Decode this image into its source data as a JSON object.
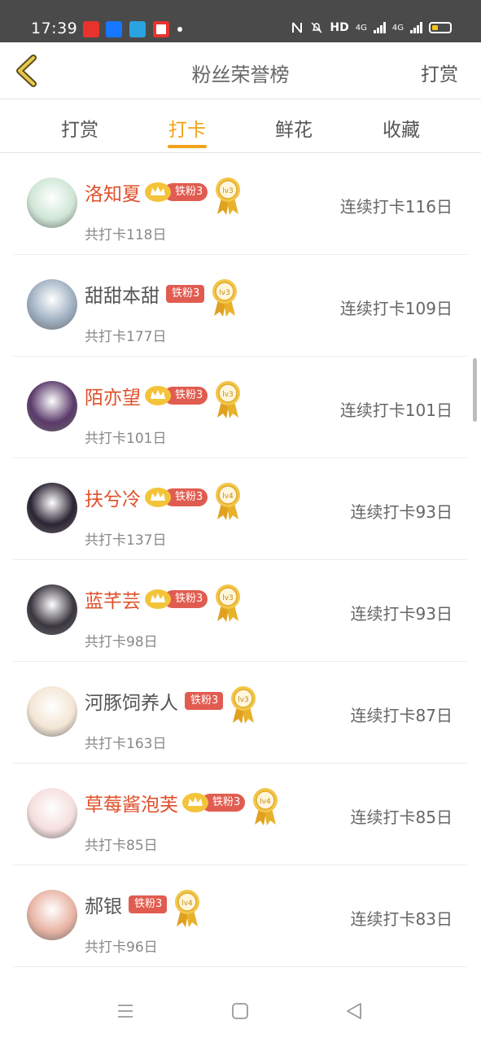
{
  "status_bar": {
    "time": "17:39",
    "hd_label": "HD",
    "network_1": "4G",
    "network_2": "4G",
    "app_icons": [
      {
        "name": "news-app-icon",
        "color": "#e8322d"
      },
      {
        "name": "alipay-app-icon",
        "color": "#1677ff"
      },
      {
        "name": "telegram-app-icon",
        "color": "#2aa3e0"
      },
      {
        "name": "video-app-icon",
        "color": "#e8322d"
      }
    ]
  },
  "header": {
    "title": "粉丝荣誉榜",
    "action_label": "打赏",
    "back_icon": "chevron-left-icon"
  },
  "tabs": [
    {
      "label": "打赏",
      "active": false
    },
    {
      "label": "打卡",
      "active": true
    },
    {
      "label": "鲜花",
      "active": false
    },
    {
      "label": "收藏",
      "active": false
    }
  ],
  "colors": {
    "accent": "#f0a21a",
    "vip_name": "#e0502b",
    "fan_badge": "#e15c50"
  },
  "ranking": [
    {
      "name": "洛知夏",
      "vip": true,
      "fan_badge": "铁粉3",
      "level": "lv3",
      "total": "共打卡118日",
      "streak": "连续打卡116日",
      "avatar_color": "#cfe6d6"
    },
    {
      "name": "甜甜本甜",
      "vip": false,
      "fan_badge": "铁粉3",
      "level": "lv3",
      "total": "共打卡177日",
      "streak": "连续打卡109日",
      "avatar_color": "#9fb0c2"
    },
    {
      "name": "陌亦望",
      "vip": true,
      "fan_badge": "铁粉3",
      "level": "lv3",
      "total": "共打卡101日",
      "streak": "连续打卡101日",
      "avatar_color": "#5a3a6a"
    },
    {
      "name": "扶兮冷",
      "vip": true,
      "fan_badge": "铁粉3",
      "level": "lv4",
      "total": "共打卡137日",
      "streak": "连续打卡93日",
      "avatar_color": "#2b2433"
    },
    {
      "name": "蓝芊芸",
      "vip": true,
      "fan_badge": "铁粉3",
      "level": "lv3",
      "total": "共打卡98日",
      "streak": "连续打卡93日",
      "avatar_color": "#3a3640"
    },
    {
      "name": "河豚饲养人",
      "vip": false,
      "fan_badge": "铁粉3",
      "level": "lv3",
      "total": "共打卡163日",
      "streak": "连续打卡87日",
      "avatar_color": "#f3e6d4"
    },
    {
      "name": "草莓酱泡芙",
      "vip": true,
      "fan_badge": "铁粉3",
      "level": "lv4",
      "total": "共打卡85日",
      "streak": "连续打卡85日",
      "avatar_color": "#f5dede"
    },
    {
      "name": "郝银",
      "vip": false,
      "fan_badge": "铁粉3",
      "level": "lv4",
      "total": "共打卡96日",
      "streak": "连续打卡83日",
      "avatar_color": "#e8b4a4"
    }
  ],
  "nav_bar": {
    "buttons": [
      "menu-icon",
      "home-icon",
      "back-triangle-icon"
    ]
  }
}
